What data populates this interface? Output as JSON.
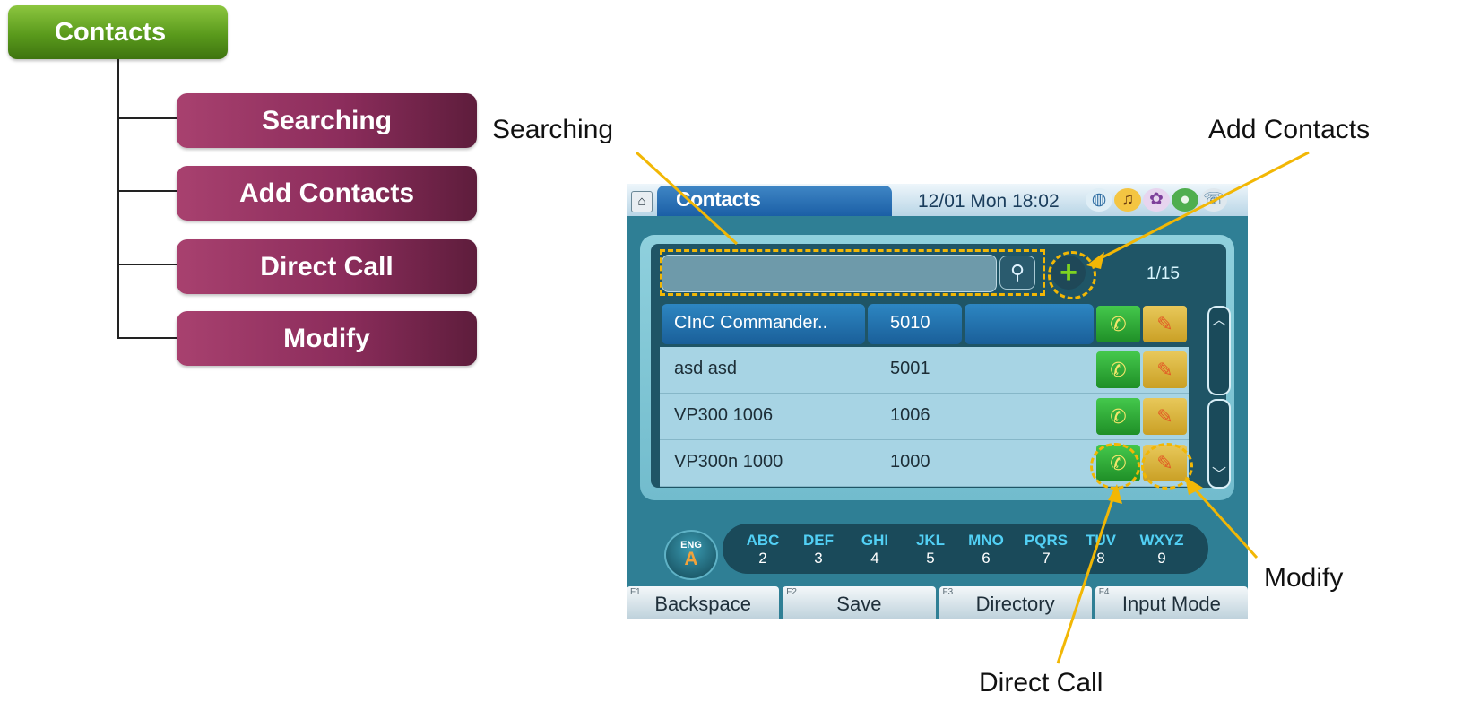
{
  "tree": {
    "root": "Contacts",
    "children": [
      "Searching",
      "Add Contacts",
      "Direct Call",
      "Modify"
    ]
  },
  "callouts": {
    "searching": "Searching",
    "add_contacts": "Add Contacts",
    "modify": "Modify",
    "direct_call": "Direct Call"
  },
  "device": {
    "title": "Contacts",
    "datetime": "12/01 Mon 18:02",
    "status_icons": [
      "globe-icon",
      "speaker-icon",
      "palette-icon",
      "network-icon",
      "phone-icon"
    ],
    "search": {
      "value": "",
      "placeholder": ""
    },
    "page": "1/15",
    "contacts": [
      {
        "name": "CInC Commander..",
        "number": "5010",
        "selected": true
      },
      {
        "name": "asd asd",
        "number": "5001",
        "selected": false
      },
      {
        "name": "VP300 1006",
        "number": "1006",
        "selected": false
      },
      {
        "name": "VP300n 1000",
        "number": "1000",
        "selected": false
      }
    ],
    "input_mode": {
      "top": "ENG",
      "bottom": "A"
    },
    "keypad": [
      {
        "letters": "ABC",
        "digit": "2"
      },
      {
        "letters": "DEF",
        "digit": "3"
      },
      {
        "letters": "GHI",
        "digit": "4"
      },
      {
        "letters": "JKL",
        "digit": "5"
      },
      {
        "letters": "MNO",
        "digit": "6"
      },
      {
        "letters": "PQRS",
        "digit": "7"
      },
      {
        "letters": "TUV",
        "digit": "8"
      },
      {
        "letters": "WXYZ",
        "digit": "9"
      }
    ],
    "function_keys": [
      {
        "tag": "F1",
        "label": "Backspace"
      },
      {
        "tag": "F2",
        "label": "Save"
      },
      {
        "tag": "F3",
        "label": "Directory"
      },
      {
        "tag": "F4",
        "label": "Input Mode"
      }
    ]
  },
  "colors": {
    "highlight": "#f2b705",
    "tree_root": "#5a9a1c",
    "tree_node": "#8c2d5c"
  }
}
